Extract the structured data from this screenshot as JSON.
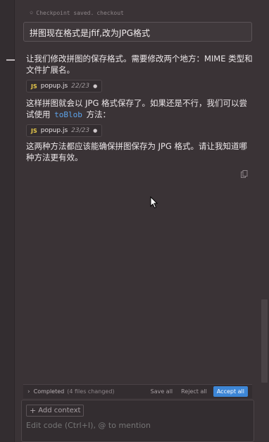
{
  "checkpoint": {
    "text": "Checkpoint saved.",
    "link": "checkout"
  },
  "user_message": "拼图现在格式是jfif,改为JPG格式",
  "assistant": {
    "paragraph1": "让我们修改拼图的保存格式。需要修改两个地方：MIME 类型和文件扩展名。",
    "chip1": {
      "icon": "JS",
      "file": "popup.js",
      "count": "22/23"
    },
    "paragraph2_before": "这样拼图就会以 JPG 格式保存了。如果还是不行，我们可以尝试使用",
    "paragraph2_code": "toBlob",
    "paragraph2_after": "方法：",
    "chip2": {
      "icon": "JS",
      "file": "popup.js",
      "count": "23/23"
    },
    "paragraph3": "这两种方法都应该能确保拼图保存为 JPG 格式。请让我知道哪种方法更有效。"
  },
  "completed_bar": {
    "label": "Completed",
    "count": "(4 files changed)",
    "save_all": "Save all",
    "reject_all": "Reject all",
    "accept_all": "Accept all"
  },
  "composer": {
    "add_context": "Add context",
    "placeholder": "Edit code (Ctrl+I), @ to mention"
  },
  "colors": {
    "background": "#3a3336",
    "accent": "#3d86d6",
    "code": "#5da3ea",
    "js_icon": "#e6c84a"
  },
  "icons": [
    "pin-icon",
    "js-file-icon",
    "copy-icon",
    "chevron-right-icon",
    "plus-icon",
    "mouse-cursor-icon"
  ]
}
